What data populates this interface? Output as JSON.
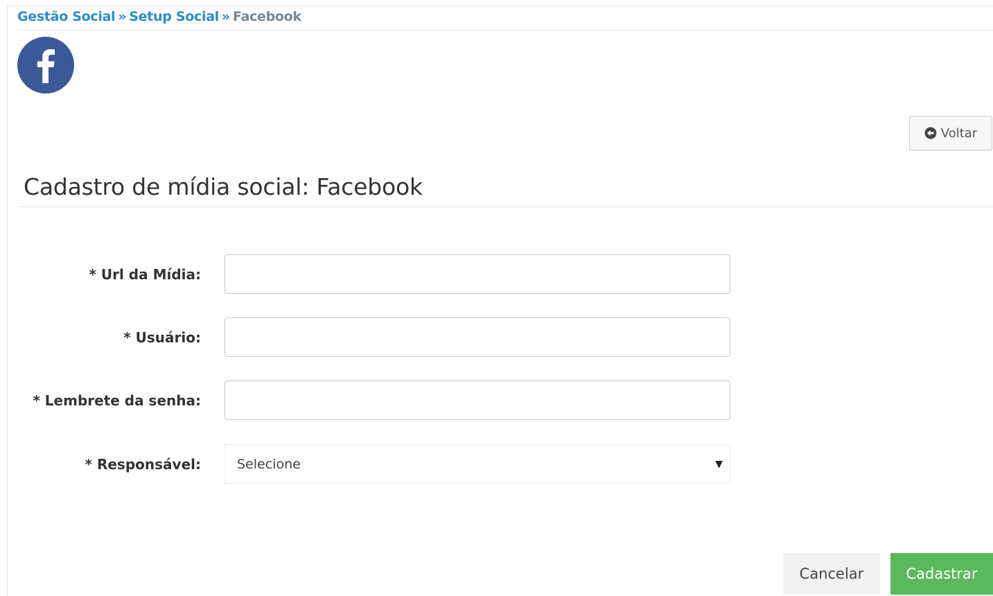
{
  "breadcrumb": {
    "items": [
      "Gestão Social",
      "Setup Social"
    ],
    "separator": "»",
    "current": "Facebook"
  },
  "logo": {
    "icon": "facebook-icon",
    "color": "#3b5998"
  },
  "back_button": {
    "label": "Voltar",
    "icon": "circle-arrow-left-icon"
  },
  "page": {
    "title": "Cadastro de mídia social: Facebook"
  },
  "form": {
    "fields": [
      {
        "label": "* Url da Mídia:",
        "value": "",
        "placeholder": ""
      },
      {
        "label": "* Usuário:",
        "value": "",
        "placeholder": ""
      },
      {
        "label": "* Lembrete da senha:",
        "value": "",
        "placeholder": ""
      }
    ],
    "select": {
      "label": "* Responsável:",
      "selected": "Selecione",
      "icon": "caret-down-icon"
    }
  },
  "actions": {
    "cancel_label": "Cancelar",
    "submit_label": "Cadastrar"
  },
  "colors": {
    "link": "#2e8bc9",
    "breadcrumb_current": "#7b8590",
    "success": "#5cb85c",
    "facebook": "#3b5998"
  }
}
